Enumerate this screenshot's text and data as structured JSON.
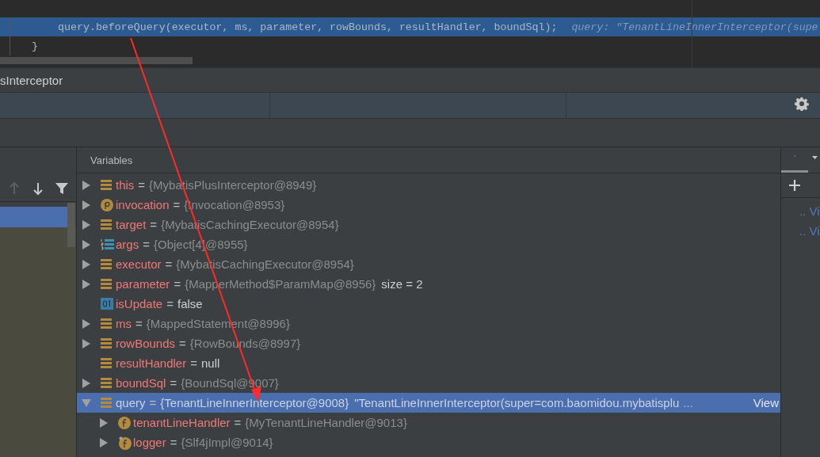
{
  "editor": {
    "lines": [
      {
        "code": "query.beforeQuery(executor, ms, parameter, rowBounds, resultHandler, boundSql);",
        "hint": "query: \"TenantLineInnerInterceptor(supe",
        "current": true
      },
      {
        "code": "}",
        "current": false
      }
    ]
  },
  "debug_title": "sInterceptor",
  "frames": {
    "toolbar": [
      {
        "kind": "up",
        "disabled": true
      },
      {
        "kind": "down",
        "disabled": false
      },
      {
        "kind": "filter",
        "disabled": false
      }
    ],
    "items": [
      {
        "selected": true
      }
    ]
  },
  "variables": {
    "title": "Variables",
    "items": [
      {
        "name": "this",
        "sep": "=",
        "value": "{MybatisPlusInterceptor@8949}",
        "literal": false,
        "kind": "object",
        "expanded": false,
        "selected": false
      },
      {
        "name": "invocation",
        "sep": "=",
        "value": "{Invocation@8953}",
        "literal": false,
        "kind": "param",
        "expanded": false,
        "selected": false
      },
      {
        "name": "target",
        "sep": "=",
        "value": "{MybatisCachingExecutor@8954}",
        "literal": false,
        "kind": "object",
        "expanded": false,
        "selected": false
      },
      {
        "name": "args",
        "sep": "=",
        "value": "{Object[4]@8955}",
        "literal": false,
        "kind": "array",
        "expanded": false,
        "selected": false
      },
      {
        "name": "executor",
        "sep": "=",
        "value": "{MybatisCachingExecutor@8954}",
        "literal": false,
        "kind": "object",
        "expanded": false,
        "selected": false
      },
      {
        "name": "parameter",
        "sep": "=",
        "value": "{MapperMethod$ParamMap@8956}",
        "extra": "size = 2",
        "literal": false,
        "kind": "object",
        "expanded": false,
        "selected": false
      },
      {
        "name": "isUpdate",
        "sep": "=",
        "value": "false",
        "literal": true,
        "kind": "primitive",
        "selected": false
      },
      {
        "name": "ms",
        "sep": "=",
        "value": "{MappedStatement@8996}",
        "literal": false,
        "kind": "object",
        "expanded": false,
        "selected": false
      },
      {
        "name": "rowBounds",
        "sep": "=",
        "value": "{RowBounds@8997}",
        "literal": false,
        "kind": "object",
        "expanded": false,
        "selected": false
      },
      {
        "name": "resultHandler",
        "sep": "=",
        "value": "null",
        "literal": true,
        "kind": "object",
        "selected": false
      },
      {
        "name": "boundSql",
        "sep": "=",
        "value": "{BoundSql@9007}",
        "literal": false,
        "kind": "object",
        "expanded": false,
        "selected": false
      },
      {
        "name": "query",
        "sep": "=",
        "value": "{TenantLineInnerInterceptor@9008}",
        "extra": "\"TenantLineInnerInterceptor(super=com.baomidou.mybatisplu",
        "ellipsis": "...",
        "link": "View",
        "literal": false,
        "kind": "object",
        "expanded": true,
        "selected": true,
        "children": [
          {
            "name": "tenantLineHandler",
            "sep": "=",
            "value": "{MyTenantLineHandler@9013}",
            "literal": false,
            "kind": "field",
            "expanded": false,
            "selected": false
          },
          {
            "name": "logger",
            "sep": "=",
            "value": "{Slf4jImpl@9014}",
            "literal": false,
            "kind": "field_static",
            "expanded": false,
            "selected": false
          }
        ]
      }
    ]
  },
  "watches": {
    "tab": "'",
    "links": [
      ".. Vi",
      ".. Vi"
    ]
  }
}
